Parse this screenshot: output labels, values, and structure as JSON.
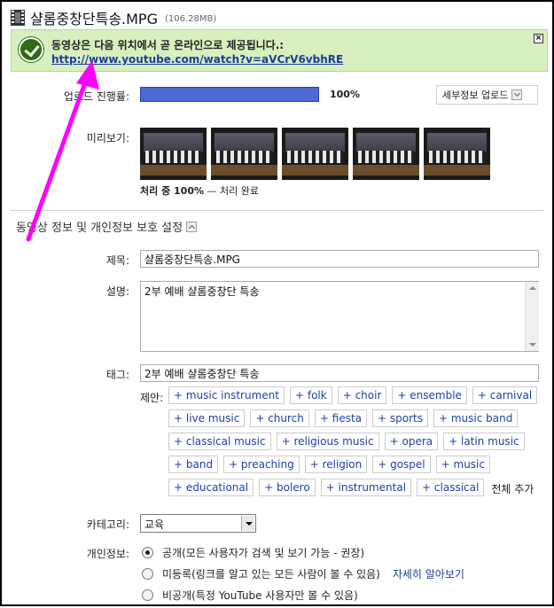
{
  "header": {
    "title": "샬롬중창단특송.MPG",
    "size": "(106.28MB)"
  },
  "notice": {
    "message": "동영상은 다음 위치에서 곧 온라인으로 제공됩니다.:",
    "link": "http://www.youtube.com/watch?v=aVCrV6vbhRE"
  },
  "upload": {
    "label": "업로드 진행률:",
    "percent": 100,
    "percent_text": "100%",
    "details_button": "세부정보 업로드"
  },
  "preview": {
    "label": "미리보기:",
    "status_bold": "처리 중 100%",
    "status_rest": " — 처리 완료"
  },
  "section_title": "동영상 정보 및 개인정보 보호 설정",
  "form": {
    "title_label": "제목:",
    "title_value": "샬롬중창단특송.MPG",
    "description_label": "설명:",
    "description_value": "2부 예배 샬롬중창단 특송",
    "tags_label": "태그:",
    "tags_value": "2부 예배 샬롬중창단 특송",
    "suggest_label": "제안:",
    "suggested_tags": [
      "+ music instrument",
      "+ folk",
      "+ choir",
      "+ ensemble",
      "+ carnival",
      "+ live music",
      "+ church",
      "+ fiesta",
      "+ sports",
      "+ music band",
      "+ classical music",
      "+ religious music",
      "+ opera",
      "+ latin music",
      "+ band",
      "+ preaching",
      "+ religion",
      "+ gospel",
      "+ music",
      "+ educational",
      "+ bolero",
      "+ instrumental",
      "+ classical"
    ],
    "add_all": "전체 추가",
    "category_label": "카테고리:",
    "category_value": "교육",
    "privacy_label": "개인정보:",
    "privacy_options": [
      {
        "label": "공개(모든 사용자가 검색 및 보기 가능 - 권장)",
        "selected": true
      },
      {
        "label": "미등록(링크를 알고 있는 모든 사람이 볼 수 있음)",
        "selected": false,
        "link": "자세히 알아보기"
      },
      {
        "label": "비공개(특정 YouTube 사용자만 볼 수 있음)",
        "selected": false
      }
    ]
  },
  "colors": {
    "accent": "#ff00ff",
    "notice_bg": "#d8f0c0",
    "progress": "#4f68d4",
    "link": "#1a3d9a"
  }
}
